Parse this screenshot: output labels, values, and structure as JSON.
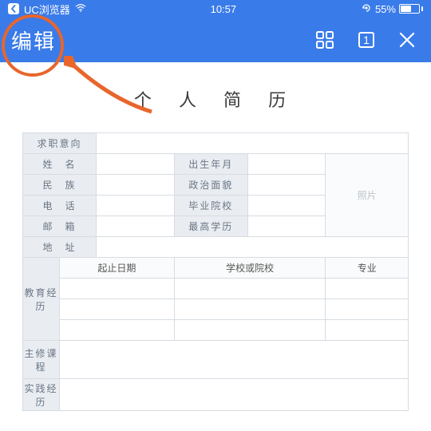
{
  "status": {
    "carrier": "UC浏览器",
    "time": "10:57",
    "battery_pct": "55%"
  },
  "toolbar": {
    "edit_label": "编辑",
    "tab_count": "1"
  },
  "doc": {
    "title": "个 人 简 历",
    "labels": {
      "intention": "求职意向",
      "name": "姓 名",
      "ethnicity": "民 族",
      "phone": "电 话",
      "email": "邮 箱",
      "address": "地 址",
      "birth": "出生年月",
      "politics": "政治面貌",
      "school": "毕业院校",
      "degree": "最高学历",
      "photo": "照片",
      "education": "教育经历",
      "period": "起止日期",
      "school_col": "学校或院校",
      "major": "专业",
      "courses": "主修课程",
      "practice": "实践经历"
    }
  }
}
